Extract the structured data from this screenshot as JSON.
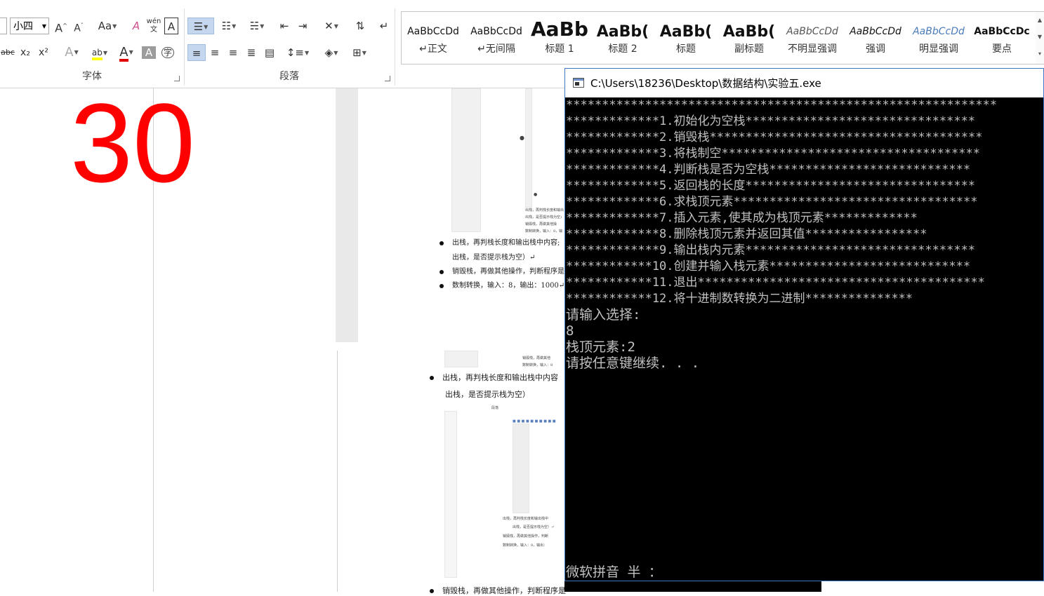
{
  "ribbon": {
    "font_group_label": "字体",
    "paragraph_group_label": "段落",
    "font_size": "小四",
    "font_buttons": {
      "grow": "A",
      "shrink": "A",
      "change_case": "Aa",
      "clear": "A",
      "phonetic": "wén文",
      "border": "A",
      "strike": "abc",
      "subscript": "x₂",
      "superscript": "x²",
      "text_effect": "A",
      "highlight": "ab",
      "font_color": "A",
      "shading": "A",
      "enclose": "字"
    },
    "styles": [
      {
        "preview": "AaBbCcDd",
        "name": "↵正文"
      },
      {
        "preview": "AaBbCcDd",
        "name": "↵无间隔"
      },
      {
        "preview": "AaBb",
        "name": "标题 1"
      },
      {
        "preview": "AaBb(",
        "name": "标题 2"
      },
      {
        "preview": "AaBb(",
        "name": "标题"
      },
      {
        "preview": "AaBb(",
        "name": "副标题"
      },
      {
        "preview": "AaBbCcDd",
        "name": "不明显强调"
      },
      {
        "preview": "AaBbCcDd",
        "name": "强调"
      },
      {
        "preview": "AaBbCcDd",
        "name": "明显强调"
      },
      {
        "preview": "AaBbCcDc",
        "name": "要点"
      }
    ],
    "colors": {
      "highlight": "#ffff00",
      "font_color": "#e00000",
      "accent": "#2b579a"
    }
  },
  "document": {
    "page_count_label": "30",
    "lines": [
      "出栈，再判栈长度和输出栈中内容;",
      "出栈，是否提示栈为空）↵",
      "销毁栈，再做其他操作，判断程序是",
      "数制转换，输入：8，输出：1000↵",
      "出栈，再判栈长度和输出栈中内容",
      "出栈，是否提示栈为空）",
      "销毁栈，再做其他操作，判断程序是"
    ],
    "tiny_lines": [
      "出栈，再判栈长度和输出",
      "出栈，是否提示栈为空)",
      "销毁栈，再做其他操",
      "数制转换，输入：8，输",
      "销毁栈，再做其他",
      "数制转换，输入：8",
      "出栈，再判栈长度和输出栈中",
      "出栈，是否提示栈为空）↵",
      "销毁栈，再做其他操作，判断",
      "数制转换，输入：8，输出：",
      "段落"
    ]
  },
  "console": {
    "title": "C:\\Users\\18236\\Desktop\\数据结构\\实验五.exe",
    "lines": [
      "************************************************************",
      "*************1.初始化为空栈********************************",
      "*************2.销毁栈**************************************",
      "*************3.将栈制空************************************",
      "*************4.判断栈是否为空栈****************************",
      "*************5.返回栈的长度********************************",
      "*************6.求栈顶元素**********************************",
      "*************7.插入元素,使其成为栈顶元素*************",
      "*************8.删除栈顶元素并返回其值*****************",
      "*************9.输出栈内元素********************************",
      "************10.创建并输入栈元素****************************",
      "************11.退出****************************************",
      "************12.将十进制数转换为二进制***************",
      "请输入选择:",
      "8",
      "栈顶元素:2",
      "请按任意键继续. . ."
    ],
    "ime_status": "微软拼音 半 ："
  }
}
